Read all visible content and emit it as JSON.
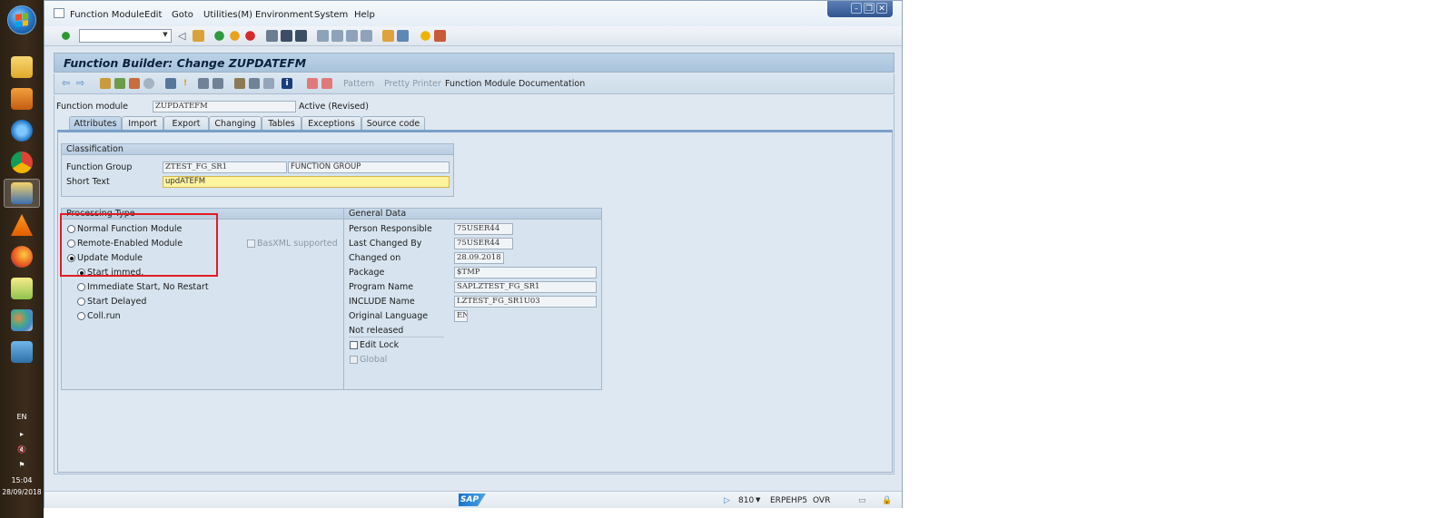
{
  "taskbar": {
    "language": "EN",
    "clock_time": "15:04",
    "clock_date": "28/09/2018"
  },
  "menu": {
    "items": [
      "Function Module",
      "Edit",
      "Goto",
      "Utilities(M)",
      "Environment",
      "System",
      "Help"
    ]
  },
  "title": "Function Builder: Change ZUPDATEFM",
  "app_toolbar": {
    "pattern": "Pattern",
    "pretty_printer": "Pretty Printer",
    "documentation": "Function Module Documentation"
  },
  "header": {
    "fm_label": "Function module",
    "fm_value": "ZUPDATEFM",
    "status": "Active (Revised)"
  },
  "tabs": [
    "Attributes",
    "Import",
    "Export",
    "Changing",
    "Tables",
    "Exceptions",
    "Source code"
  ],
  "classification": {
    "title": "Classification",
    "fg_label": "Function Group",
    "fg_value": "ZTEST_FG_SR1",
    "fg_desc": "FUNCTION GROUP",
    "short_text_label": "Short Text",
    "short_text_value": "updATEFM"
  },
  "processing": {
    "title": "Processing Type",
    "normal": "Normal Function Module",
    "remote": "Remote-Enabled Module",
    "basxml": "BasXML supported",
    "update": "Update Module",
    "start_immed": "Start immed.",
    "immediate_no_restart": "Immediate Start, No Restart",
    "start_delayed": "Start Delayed",
    "coll_run": "Coll.run"
  },
  "general": {
    "title": "General Data",
    "person_label": "Person Responsible",
    "person_value": "75USER44",
    "last_changed_label": "Last Changed By",
    "last_changed_value": "75USER44",
    "changed_on_label": "Changed on",
    "changed_on_value": "28.09.2018",
    "package_label": "Package",
    "package_value": "$TMP",
    "program_label": "Program Name",
    "program_value": "SAPLZTEST_FG_SR1",
    "include_label": "INCLUDE Name",
    "include_value": "LZTEST_FG_SR1U03",
    "orig_lang_label": "Original Language",
    "orig_lang_value": "EN",
    "not_released": "Not released",
    "edit_lock": "Edit Lock",
    "global": "Global"
  },
  "statusbar": {
    "logo": "SAP",
    "client": "810",
    "system": "ERPEHP5",
    "mode": "OVR"
  }
}
